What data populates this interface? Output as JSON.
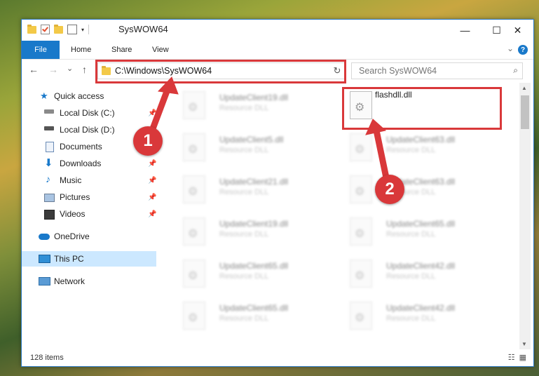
{
  "window": {
    "title": "SysWOW64",
    "controls": {
      "minimize": "—",
      "maximize": "☐",
      "close": "✕"
    }
  },
  "ribbon": {
    "file": "File",
    "tabs": [
      "Home",
      "Share",
      "View"
    ],
    "help": "?",
    "collapse": "⌄"
  },
  "navigation": {
    "back": "←",
    "forward": "→",
    "recent": "⌄",
    "up": "↑",
    "address": "C:\\Windows\\SysWOW64",
    "address_drop": "⌄",
    "refresh": "↻",
    "search_placeholder": "Search SysWOW64",
    "search_icon": "⌕"
  },
  "sidebar": {
    "items": [
      {
        "label": "Quick access",
        "icon": "star-icon",
        "pinned": false
      },
      {
        "label": "Local Disk (C:)",
        "icon": "drive-icon",
        "pinned": true
      },
      {
        "label": "Local Disk (D:)",
        "icon": "drive-icon",
        "pinned": false
      },
      {
        "label": "Documents",
        "icon": "documents-icon",
        "pinned": true
      },
      {
        "label": "Downloads",
        "icon": "download-icon",
        "pinned": true
      },
      {
        "label": "Music",
        "icon": "music-icon",
        "pinned": true
      },
      {
        "label": "Pictures",
        "icon": "pictures-icon",
        "pinned": true
      },
      {
        "label": "Videos",
        "icon": "videos-icon",
        "pinned": true
      },
      {
        "label": "OneDrive",
        "icon": "cloud-icon",
        "pinned": false
      },
      {
        "label": "This PC",
        "icon": "pc-icon",
        "pinned": false
      },
      {
        "label": "Network",
        "icon": "network-icon",
        "pinned": false
      }
    ],
    "pin_glyph": "📌"
  },
  "files": {
    "highlighted": {
      "name": "flashdll.dll"
    },
    "left_column": [
      {
        "name": "UpdateClient19.dll",
        "type": "Resource DLL"
      },
      {
        "name": "UpdateClient5.dll",
        "type": "Resource DLL"
      },
      {
        "name": "UpdateClient21.dll",
        "type": "Resource DLL"
      },
      {
        "name": "UpdateClient19.dll",
        "type": "Resource DLL"
      },
      {
        "name": "UpdateClient65.dll",
        "type": "Resource DLL"
      },
      {
        "name": "UpdateClient65.dll",
        "type": "Resource DLL"
      }
    ],
    "right_column": [
      {
        "name": "UpdateClient63.dll",
        "type": "Resource DLL"
      },
      {
        "name": "UpdateClient63.dll",
        "type": "Resource DLL"
      },
      {
        "name": "UpdateClient65.dll",
        "type": "Resource DLL"
      },
      {
        "name": "UpdateClient42.dll",
        "type": "Resource DLL"
      },
      {
        "name": "UpdateClient42.dll",
        "type": "Resource DLL"
      }
    ]
  },
  "status": {
    "item_count": "128 items",
    "view_details": "☷",
    "view_tiles": "▦"
  },
  "annotations": {
    "step1": "1",
    "step2": "2",
    "color": "#d9383a"
  }
}
